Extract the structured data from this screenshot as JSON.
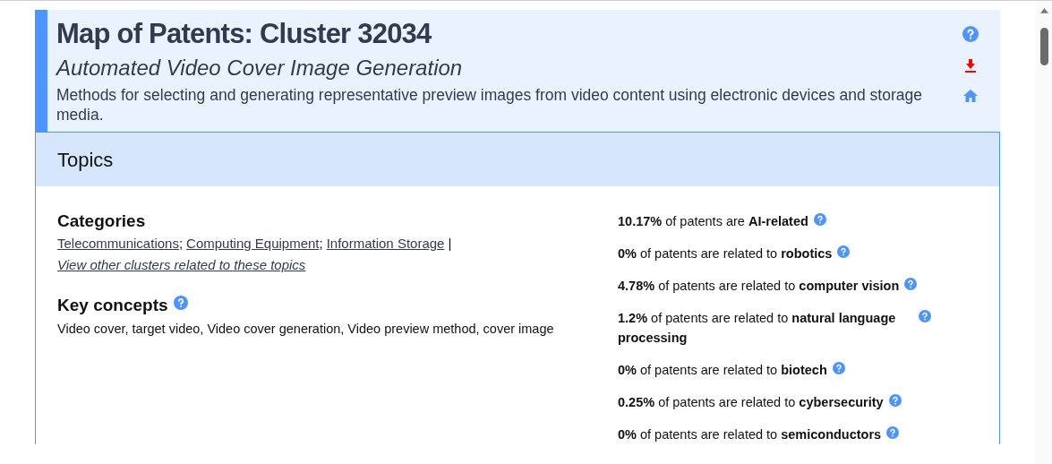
{
  "header": {
    "title": "Map of Patents: Cluster 32034",
    "subtitle": "Automated Video Cover Image Generation",
    "description": "Methods for selecting and generating representative preview images from video content using electronic devices and storage media."
  },
  "section": {
    "title": "Topics"
  },
  "categories": {
    "heading": "Categories",
    "links": [
      {
        "label": "Telecommunications",
        "separator": ";"
      },
      {
        "label": "Computing Equipment",
        "separator": ";"
      },
      {
        "label": "Information Storage",
        "separator": "|"
      }
    ],
    "other_link": "View other clusters related to these topics"
  },
  "key_concepts": {
    "heading": "Key concepts",
    "text": "Video cover, target video, Video cover generation, Video preview method, cover image"
  },
  "stats": [
    {
      "text": "**10.17%** of patents are **AI-related**"
    },
    {
      "text": "**0%** of patents are related to **robotics**"
    },
    {
      "text": "**4.78%** of patents are related to **computer vision**"
    },
    {
      "text": "**1.2%** of patents are related to **natural language processing**"
    },
    {
      "text": "**0%** of patents are related to **biotech**"
    },
    {
      "text": "**0.25%** of patents are related to **cybersecurity**"
    },
    {
      "text": "**0%** of patents are related to **semiconductors**"
    }
  ]
}
